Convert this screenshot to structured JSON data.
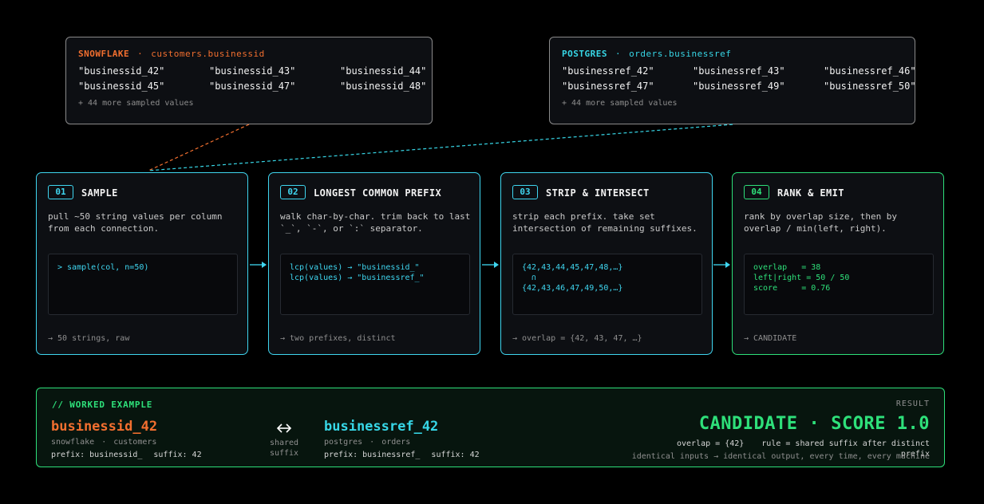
{
  "sources": {
    "snowflake": {
      "db": "SNOWFLAKE",
      "sep": "·",
      "column": "customers.businessid",
      "values": [
        "\"businessid_42\"",
        "\"businessid_43\"",
        "\"businessid_44\"",
        "\"businessid_45\"",
        "\"businessid_47\"",
        "\"businessid_48\""
      ],
      "more": "+ 44 more sampled values",
      "color": "#f26f2f"
    },
    "postgres": {
      "db": "POSTGRES",
      "sep": "·",
      "column": "orders.businessref",
      "values": [
        "\"businessref_42\"",
        "\"businessref_43\"",
        "\"businessref_46\"",
        "\"businessref_47\"",
        "\"businessref_49\"",
        "\"businessref_50\""
      ],
      "more": "+ 44 more sampled values",
      "color": "#37d6e6"
    }
  },
  "steps": [
    {
      "num": "01",
      "title": "SAMPLE",
      "desc": "pull ~50 string values per column from each connection.",
      "code": "> sample(col, n=50)",
      "out": "→ 50 strings, raw",
      "color": "#3fd6f0"
    },
    {
      "num": "02",
      "title": "LONGEST COMMON PREFIX",
      "desc": "walk char-by-char. trim back to last `_`, `-`, or `:` separator.",
      "code": "lcp(values) → \"businessid_\"\nlcp(values) → \"businessref_\"",
      "out": "→ two prefixes, distinct",
      "color": "#3fd6f0"
    },
    {
      "num": "03",
      "title": "STRIP & INTERSECT",
      "desc": "strip each prefix. take set intersection of remaining suffixes.",
      "code": "{42,43,44,45,47,48,…}\n  ∩\n{42,43,46,47,49,50,…}",
      "out": "→ overlap = {42, 43, 47, …}",
      "color": "#3fd6f0"
    },
    {
      "num": "04",
      "title": "RANK & EMIT",
      "desc": "rank by overlap size, then by overlap / min(left, right).",
      "code": "overlap   = 38\nleft|right = 50 / 50\nscore     = 0.76",
      "out": "→ CANDIDATE",
      "color": "#2ee07a"
    }
  ],
  "worked": {
    "label": "// WORKED EXAMPLE",
    "result_label": "RESULT",
    "left": {
      "id": "businessid_42",
      "db": "snowflake",
      "sep": "·",
      "table": "customers",
      "prefix": "prefix: businessid_",
      "suffix": "suffix: 42"
    },
    "middle": {
      "icon": "bidirectional-arrow-icon",
      "label": "shared suffix"
    },
    "right": {
      "id": "businessref_42",
      "db": "postgres",
      "sep": "·",
      "table": "orders",
      "prefix": "prefix: businessref_",
      "suffix": "suffix: 42"
    },
    "verdict": "CANDIDATE",
    "verdict_sep": "·",
    "score": "SCORE 1.0",
    "overlap": "overlap = {42}",
    "rule": "rule = shared suffix after distinct prefix",
    "note": "identical inputs → identical output, every time, every machine"
  }
}
